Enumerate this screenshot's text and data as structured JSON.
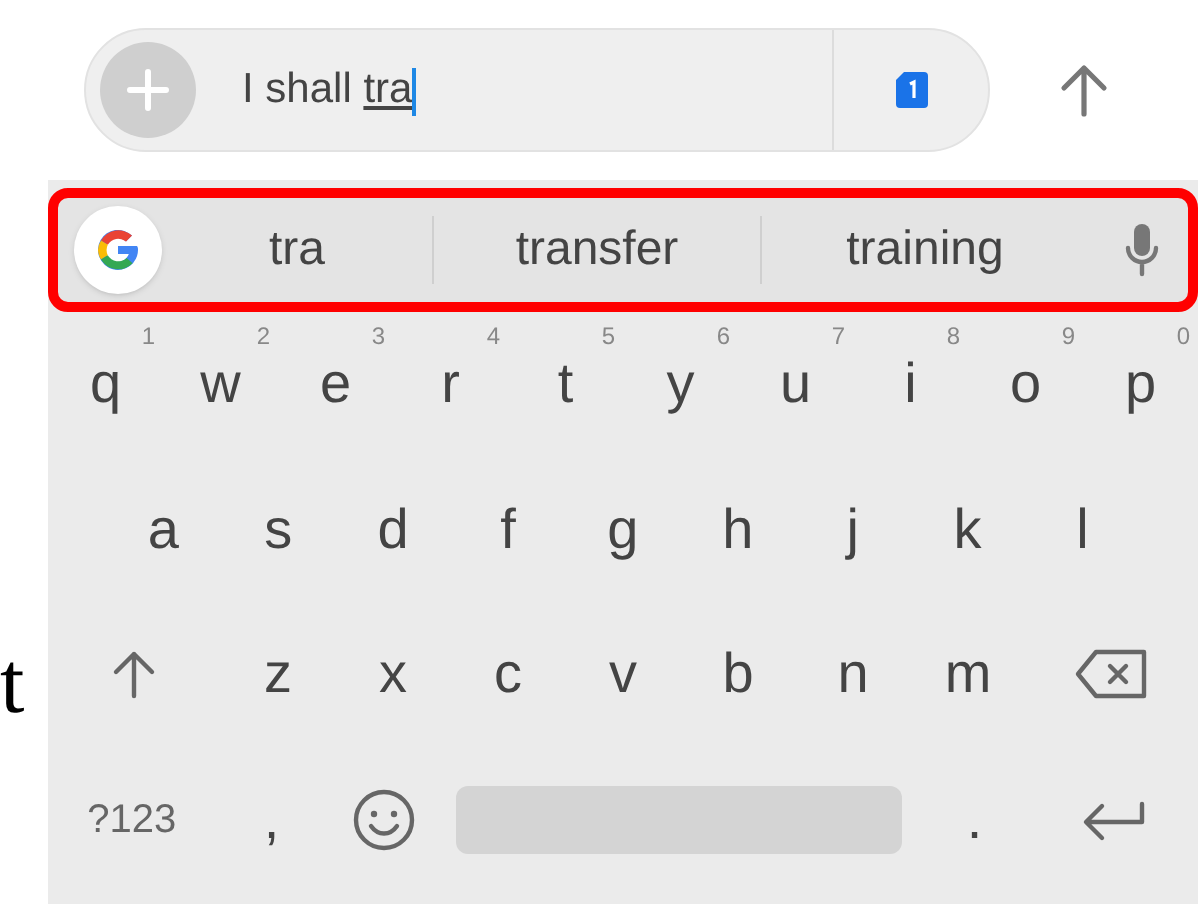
{
  "composer": {
    "typed": "I shall ",
    "composing": "tra"
  },
  "suggestions": [
    "tra",
    "transfer",
    "training"
  ],
  "suggestions_highlighted": true,
  "rows": [
    [
      {
        "kind": "letter",
        "label": "q",
        "hint": "1"
      },
      {
        "kind": "letter",
        "label": "w",
        "hint": "2"
      },
      {
        "kind": "letter",
        "label": "e",
        "hint": "3"
      },
      {
        "kind": "letter",
        "label": "r",
        "hint": "4"
      },
      {
        "kind": "letter",
        "label": "t",
        "hint": "5"
      },
      {
        "kind": "letter",
        "label": "y",
        "hint": "6"
      },
      {
        "kind": "letter",
        "label": "u",
        "hint": "7"
      },
      {
        "kind": "letter",
        "label": "i",
        "hint": "8"
      },
      {
        "kind": "letter",
        "label": "o",
        "hint": "9"
      },
      {
        "kind": "letter",
        "label": "p",
        "hint": "0"
      }
    ],
    [
      {
        "kind": "letter",
        "label": "a"
      },
      {
        "kind": "letter",
        "label": "s"
      },
      {
        "kind": "letter",
        "label": "d"
      },
      {
        "kind": "letter",
        "label": "f"
      },
      {
        "kind": "letter",
        "label": "g"
      },
      {
        "kind": "letter",
        "label": "h"
      },
      {
        "kind": "letter",
        "label": "j"
      },
      {
        "kind": "letter",
        "label": "k"
      },
      {
        "kind": "letter",
        "label": "l"
      }
    ],
    [
      {
        "kind": "shift"
      },
      {
        "kind": "letter",
        "label": "z"
      },
      {
        "kind": "letter",
        "label": "x"
      },
      {
        "kind": "letter",
        "label": "c"
      },
      {
        "kind": "letter",
        "label": "v"
      },
      {
        "kind": "letter",
        "label": "b"
      },
      {
        "kind": "letter",
        "label": "n"
      },
      {
        "kind": "letter",
        "label": "m"
      },
      {
        "kind": "backspace"
      }
    ],
    [
      {
        "kind": "symbols",
        "label": "?123"
      },
      {
        "kind": "punct",
        "label": ","
      },
      {
        "kind": "emoji"
      },
      {
        "kind": "space"
      },
      {
        "kind": "punct",
        "label": "."
      },
      {
        "kind": "enter"
      }
    ]
  ],
  "side_text": "t"
}
